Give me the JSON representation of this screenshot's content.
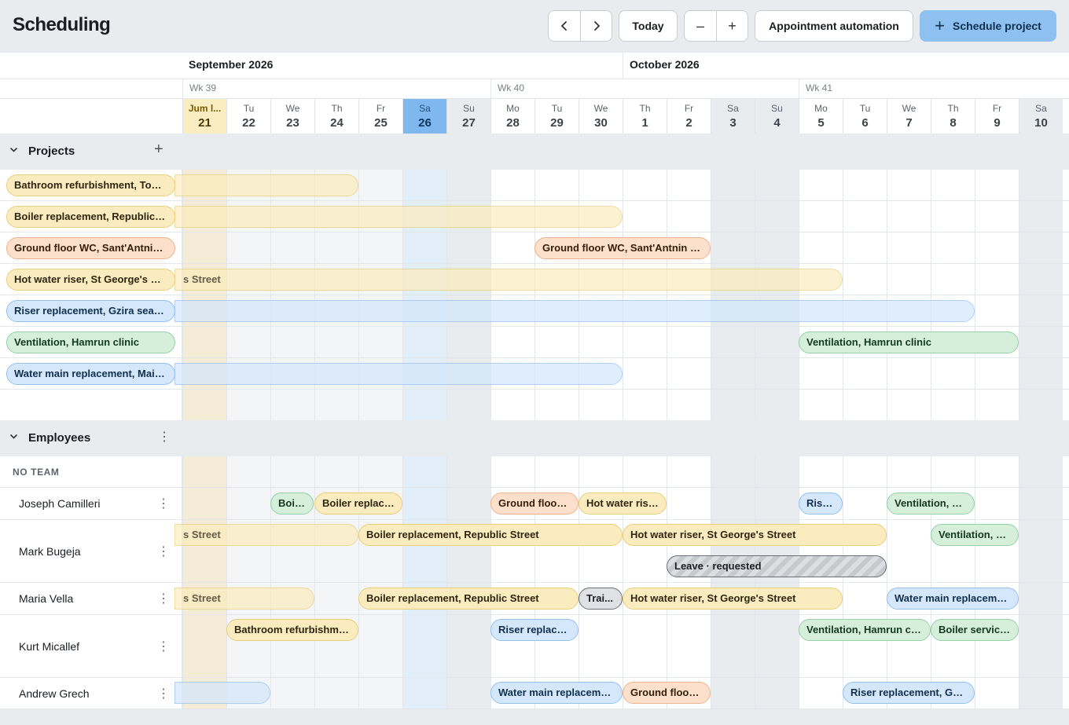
{
  "header": {
    "title": "Scheduling",
    "prev_icon": "chevron-left-icon",
    "next_icon": "chevron-right-icon",
    "today_label": "Today",
    "zoom_out_label": "–",
    "zoom_in_label": "+",
    "automation_label": "Appointment automation",
    "schedule_label": "Schedule project",
    "schedule_icon": "+"
  },
  "timeline": {
    "months": [
      "September 2026",
      "October 2026"
    ],
    "weeks": [
      "Wk 39",
      "Wk 40",
      "Wk 41"
    ],
    "days": [
      {
        "name": "Jum l...",
        "num": "21"
      },
      {
        "name": "Tu",
        "num": "22"
      },
      {
        "name": "We",
        "num": "23"
      },
      {
        "name": "Th",
        "num": "24"
      },
      {
        "name": "Fr",
        "num": "25"
      },
      {
        "name": "Sa",
        "num": "26"
      },
      {
        "name": "Su",
        "num": "27"
      },
      {
        "name": "Mo",
        "num": "28"
      },
      {
        "name": "Tu",
        "num": "29"
      },
      {
        "name": "We",
        "num": "30"
      },
      {
        "name": "Th",
        "num": "1"
      },
      {
        "name": "Fr",
        "num": "2"
      },
      {
        "name": "Sa",
        "num": "3"
      },
      {
        "name": "Su",
        "num": "4"
      },
      {
        "name": "Mo",
        "num": "5"
      },
      {
        "name": "Tu",
        "num": "6"
      },
      {
        "name": "We",
        "num": "7"
      },
      {
        "name": "Th",
        "num": "8"
      },
      {
        "name": "Fr",
        "num": "9"
      },
      {
        "name": "Sa",
        "num": "10"
      }
    ]
  },
  "projects": {
    "title": "Projects",
    "add_label": "+",
    "rows": [
      {
        "label": "Bathroom refurbishment, Towe...",
        "color": "yellow"
      },
      {
        "label": "Boiler replacement, Republic St...",
        "color": "yellow"
      },
      {
        "label": "Ground floor WC, Sant'Antnin S...",
        "color": "orange"
      },
      {
        "label": "Hot water riser, St George's Str...",
        "color": "yellow"
      },
      {
        "label": "Riser replacement, Gzira seafro...",
        "color": "blue"
      },
      {
        "label": "Ventilation, Hamrun clinic",
        "color": "green"
      },
      {
        "label": "Water main replacement, Main ...",
        "color": "blue"
      }
    ],
    "bars": {
      "ground_floor": "Ground floor WC, Sant'Antnin Str...",
      "hot_water": "s Street",
      "ventilation": "Ventilation, Hamrun clinic"
    }
  },
  "employees": {
    "title": "Employees",
    "menu_label": "⋮",
    "team_label": "NO TEAM",
    "people": [
      {
        "name": "Joseph Camilleri"
      },
      {
        "name": "Mark Bugeja"
      },
      {
        "name": "Maria Vella"
      },
      {
        "name": "Kurt Micallef"
      },
      {
        "name": "Andrew Grech"
      }
    ],
    "chips": {
      "jc1": "Boil...",
      "jc2": "Boiler replace...",
      "jc3": "Ground floor ...",
      "jc4": "Hot water rise...",
      "jc5": "Rise...",
      "jc6": "Ventilation, H...",
      "mb1": "s Street",
      "mb2": "Boiler replacement, Republic Street",
      "mb3": "Hot water riser, St George's Street",
      "mb4": "Ventilation, H...",
      "mb5": "Leave · requested",
      "mv1": "s Street",
      "mv2": "Boiler replacement, Republic Street",
      "mv3": "Trai...",
      "mv4": "Hot water riser, St George's Street",
      "mv5": "Water main replacemen...",
      "km1": "Bathroom refurbishme...",
      "km2": "Riser replace...",
      "km3": "Ventilation, Hamrun cli...",
      "km4": "Boiler service...",
      "ag2": "Water main replacemen...",
      "ag3": "Ground floor ...",
      "ag4": "Riser replacement, Gzir..."
    }
  }
}
